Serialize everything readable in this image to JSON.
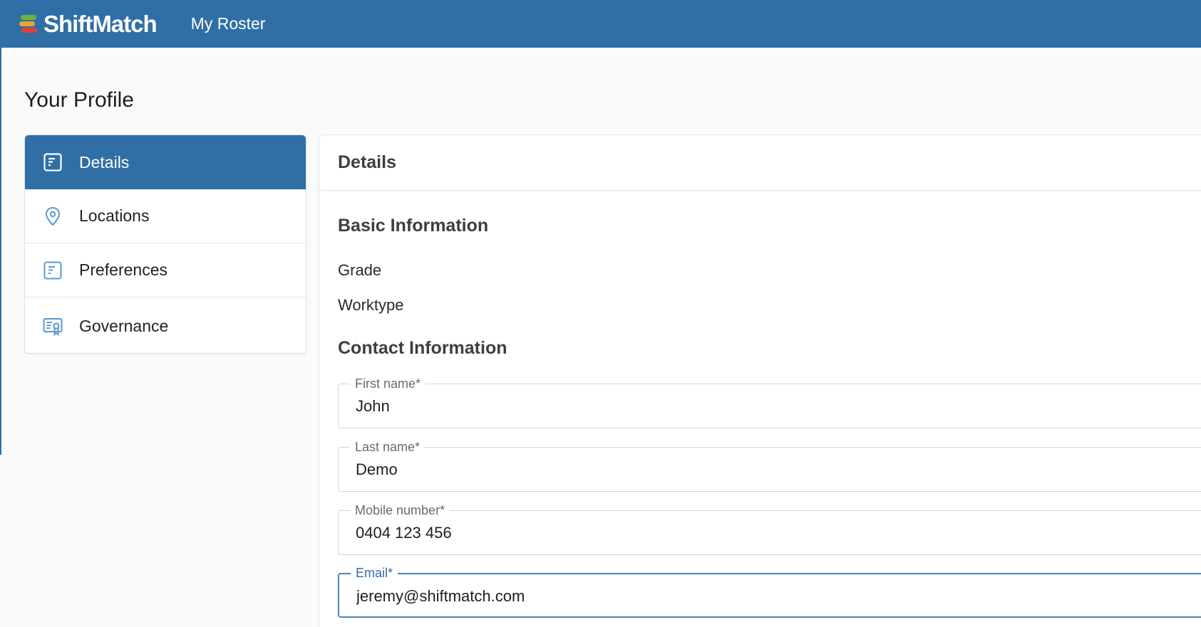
{
  "app": {
    "brand_name": "ShiftMatch",
    "nav_link": "My Roster",
    "colors": {
      "primary": "#2f6fa6",
      "logo_green": "#6db33f",
      "logo_orange": "#f0a030",
      "logo_red": "#e0403a"
    }
  },
  "page": {
    "title": "Your Profile"
  },
  "sidebar": {
    "items": [
      {
        "label": "Details",
        "icon": "document-icon",
        "active": true
      },
      {
        "label": "Locations",
        "icon": "location-pin-icon",
        "active": false
      },
      {
        "label": "Preferences",
        "icon": "document-icon",
        "active": false
      },
      {
        "label": "Governance",
        "icon": "certificate-icon",
        "active": false
      }
    ]
  },
  "card": {
    "header": "Details",
    "basic_info": {
      "title": "Basic Information",
      "grade_label": "Grade",
      "worktype_label": "Worktype"
    },
    "contact_info": {
      "title": "Contact Information",
      "fields": [
        {
          "label": "First name*",
          "value": "John"
        },
        {
          "label": "Last name*",
          "value": "Demo"
        },
        {
          "label": "Mobile number*",
          "value": "0404 123 456"
        },
        {
          "label": "Email*",
          "value": "jeremy@shiftmatch.com",
          "focused": true
        }
      ]
    }
  }
}
